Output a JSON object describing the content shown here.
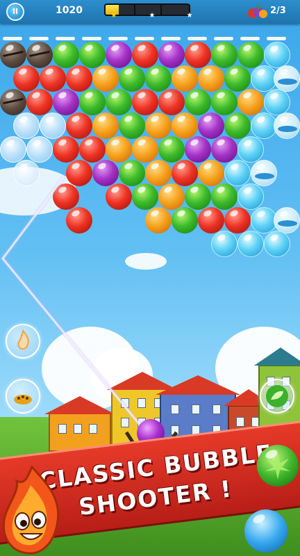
{
  "hud": {
    "pause_icon": "pause-icon",
    "pause_label": "II",
    "score": "1020",
    "progress": 0.16,
    "progress_stars": [
      "star-icon",
      "star-icon",
      "star-icon"
    ],
    "stars_earned": 1,
    "level_icon": "fruit-icon",
    "level_count": "2/3"
  },
  "banner": {
    "line1": "CLASSIC BUBBLE",
    "line2": "SHOOTER !"
  },
  "boosters": [
    {
      "name": "fire-booster",
      "icon": "flame-icon"
    },
    {
      "name": "bomb-booster",
      "icon": "bomb-icon"
    },
    {
      "name": "leaf-booster",
      "icon": "leaf-icon"
    }
  ],
  "shooter": {
    "color": "purple"
  },
  "colors": {
    "accent": "#e63a29",
    "hud": "#1e73b0",
    "progress": "#ffd400"
  },
  "board": [
    [
      "rock",
      "rock",
      "green",
      "green",
      "purple",
      "red",
      "purple",
      "red",
      "green",
      "green",
      "cyan"
    ],
    [
      "red",
      "red",
      "red",
      "orange",
      "green",
      "green",
      "orange",
      "orange",
      "green",
      "cyan",
      "ice"
    ],
    [
      "rock",
      "red",
      "purple",
      "green",
      "green",
      "red",
      "red",
      "green",
      "green",
      "orange",
      "cyan"
    ],
    [
      "ghost",
      "ghost",
      "red",
      "orange",
      "green",
      "orange",
      "orange",
      "purple",
      "green",
      "cyan",
      "ice"
    ],
    [
      "ghost",
      "ghost",
      "red",
      "red",
      "orange",
      "orange",
      "green",
      "purple",
      "purple",
      "cyan"
    ],
    [
      "ghost",
      "",
      "red",
      "purple",
      "green",
      "orange",
      "red",
      "orange",
      "cyan",
      "ice"
    ],
    [
      "",
      "",
      "red",
      "",
      "red",
      "green",
      "orange",
      "green",
      "green",
      "cyan"
    ],
    [
      "",
      "",
      "red",
      "",
      "",
      "orange",
      "green",
      "red",
      "red",
      "cyan",
      "ice"
    ],
    [
      "",
      "",
      "",
      "",
      "",
      "",
      "",
      "",
      "cyan",
      "cyan",
      "cyan"
    ]
  ]
}
